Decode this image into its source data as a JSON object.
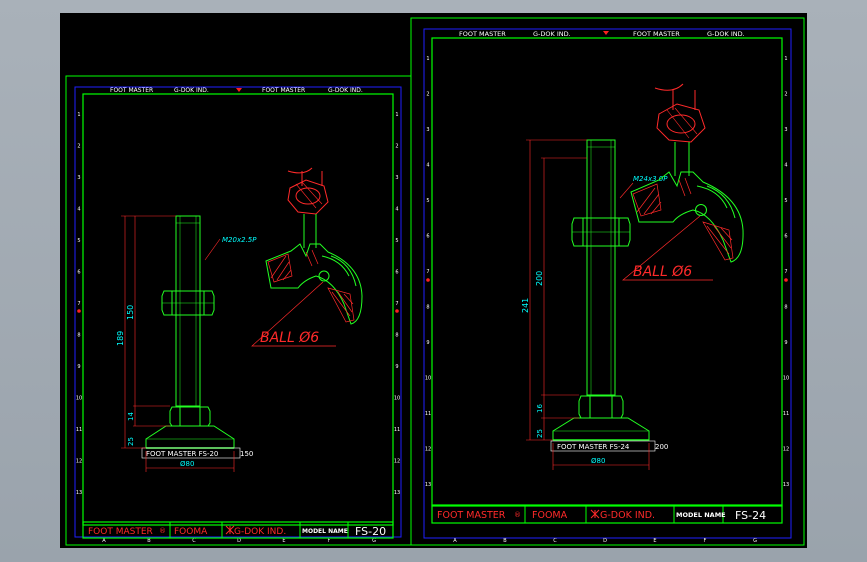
{
  "colors": {
    "background": "#000000",
    "frame_green": "#00ff00",
    "border_blue": "#2020ff",
    "dimension_cyan": "#00ffff",
    "part_green": "#22ff22",
    "section_red": "#ff2a2a",
    "label_white": "#ffffff",
    "zone_marker_red": "#ff2020"
  },
  "sheets": [
    {
      "title_block": {
        "brand": "FOOT MASTER",
        "reg_mark": "®",
        "series": "FOOMA",
        "maker": "G-DOK IND.",
        "model_label": "MODEL  NAME",
        "model": "FS-20"
      },
      "header": {
        "brand_left": "FOOT MASTER",
        "maker_left": "G-DOK IND.",
        "brand_right": "FOOT MASTER",
        "maker_right": "G-DOK IND."
      },
      "zones_rows": [
        "1",
        "2",
        "3",
        "4",
        "5",
        "6",
        "7",
        "8",
        "9",
        "10",
        "11",
        "12",
        "13"
      ],
      "zones_cols": [
        "A",
        "B",
        "C",
        "D",
        "E",
        "F",
        "G"
      ],
      "dims": {
        "thread": "M20x2.5P",
        "thread_len": "150",
        "total_height": "189",
        "nut_height": "14",
        "base_height": "25",
        "base_dia": "Ø80",
        "stem_label": "FOOT MASTER  FS-20",
        "stem_len": "150"
      },
      "ball_label": "BALL  Ø6"
    },
    {
      "title_block": {
        "brand": "FOOT MASTER",
        "reg_mark": "®",
        "series": "FOOMA",
        "maker": "G-DOK IND.",
        "model_label": "MODEL  NAME",
        "model": "FS-24"
      },
      "header": {
        "brand_left": "FOOT MASTER",
        "maker_left": "G-DOK IND.",
        "brand_right": "FOOT MASTER",
        "maker_right": "G-DOK IND."
      },
      "zones_rows": [
        "1",
        "2",
        "3",
        "4",
        "5",
        "6",
        "7",
        "8",
        "9",
        "10",
        "11",
        "12",
        "13"
      ],
      "zones_cols": [
        "A",
        "B",
        "C",
        "D",
        "E",
        "F",
        "G"
      ],
      "dims": {
        "thread": "M24x3.0P",
        "thread_len": "200",
        "total_height": "241",
        "nut_height": "16",
        "base_height": "25",
        "base_dia": "Ø80",
        "stem_label": "FOOT MASTER  FS-24",
        "stem_len": "200"
      },
      "ball_label": "BALL  Ø6"
    }
  ]
}
